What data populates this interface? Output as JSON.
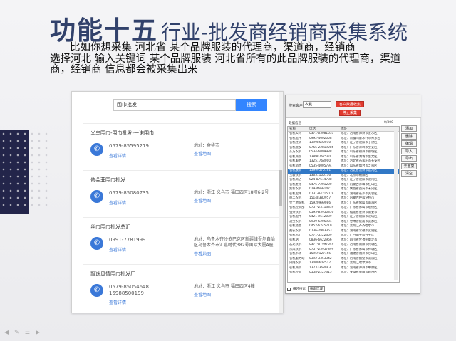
{
  "slide": {
    "title_big": "功能十五",
    "title_sub": "行业-批发商经销商采集系统",
    "desc_line1": "比如你想采集 河北省 某个品牌服装的代理商，渠道商，经销商",
    "desc_line2": "选择河北 输入关键词 某个品牌服装  河北省所有的此品牌服装的代理商，渠道",
    "desc_line3": "商，经销商  信息都会被采集出来"
  },
  "browser": {
    "search_value": "围巾批发",
    "search_button": "搜索",
    "results": [
      {
        "name": "义乌围巾-围巾批发-一诺围巾",
        "phone": "0579-85595219",
        "phone2": "",
        "detail": "查看详情",
        "addr": "地址：金华市",
        "map": "查看地图"
      },
      {
        "name": "依朵菲围巾批发",
        "phone": "0579-85080735",
        "phone2": "",
        "detail": "查看详情",
        "addr": "地址：浙江 义乌市 福田四区18幢6-2号",
        "map": "查看地图"
      },
      {
        "name": "丝巾围巾批发总汇",
        "phone": "0991-7781999",
        "phone2": "",
        "detail": "查看详情",
        "addr": "地址：乌鲁木齐沙依巴克区新疆维吾尔自治区乌鲁木齐市汇嘉时代382号国际大厦A座",
        "map": "查看地图"
      },
      {
        "name": "飘逸风情围巾批发厂",
        "phone": "0579-85054648",
        "phone2": "15988500199",
        "detail": "查看详情",
        "addr": "地址：浙江 义乌市 福田四区4幢",
        "map": "查看地图"
      }
    ]
  },
  "app": {
    "keyword_label": "搜索客户",
    "keyword_value": "农机",
    "btn_start": "客户数据收集",
    "btn_stop": "停止采集",
    "data_label": "数据信息",
    "count": "0/300",
    "columns": [
      "名称",
      "电话",
      "地址"
    ],
    "rows": [
      [
        "农机公司",
        "0371-65081631",
        "地址：河南省郑州市金水区"
      ],
      [
        "农机配件",
        "0992-4602058",
        "地址：新疆乌鲁木齐市米东区"
      ],
      [
        "农机经销",
        "13998590010",
        "地址：辽宁省沈阳市于洪区"
      ],
      [
        "农机批发",
        "0755-22819286",
        "地址：广东省深圳市宝安区"
      ],
      [
        "东方农机",
        "0534-6099988",
        "地址：山东省德州市德城区"
      ],
      [
        "农机商城",
        "13898767590",
        "地址：山东省潍坊市奎文区"
      ],
      [
        "农机服务",
        "13251768000",
        "地址：河北省石家庄市长安区"
      ],
      [
        "农机销售",
        "0535-4005794",
        "地址：山东省烟台市芝罘区"
      ],
      [
        "农机展销",
        "13999570161",
        "地址：河北省沧州市运河区"
      ],
      [
        "宝骏农机",
        "13651106116",
        "地址：北京市朝阳区"
      ],
      [
        "农机商店",
        "024-87514788",
        "地址：辽宁省沈阳市沈河区"
      ],
      [
        "农机维修",
        "0476-7201200",
        "地址：内蒙古赤峰市红山区"
      ],
      [
        "凯新农机",
        "029-46661471",
        "地址：陕西省西安市未央区"
      ],
      [
        "农机配件",
        "0731-84215079",
        "地址：湖南省长沙市芙蓉区"
      ],
      [
        "益丰农机",
        "15148380957",
        "地址：内蒙古呼和浩特市"
      ],
      [
        "金土地农机",
        "15920999086",
        "地址：广东省佛山市南海区"
      ],
      [
        "农机经销部",
        "0757-23113339",
        "地址：广东省佛山市顺德区"
      ],
      [
        "强兴农机",
        "0595-85950350",
        "地址：福建省泉州市南安市"
      ],
      [
        "农机配件",
        "0421-9512039",
        "地址：辽宁省朝阳市双塔区"
      ],
      [
        "通宝农机",
        "0939-5205934",
        "地址：甘肃省陇南市武都区"
      ],
      [
        "农机经营",
        "0452-6245719",
        "地址：黑龙江齐齐哈尔市"
      ],
      [
        "鑫农农机",
        "0736-2993363",
        "地址：湖南省常德市武陵区"
      ],
      [
        "农机总汇",
        "0771-5222369",
        "地址：广西南宁市兴宁区"
      ],
      [
        "农机站",
        "0836-6622966",
        "地址：四川省甘孜州康定市"
      ],
      [
        "宏达农机",
        "0377-67997549",
        "地址：河南省南阳市宛城区"
      ],
      [
        "东风农机",
        "0757-25957899",
        "地址：广东省佛山市禅城区"
      ],
      [
        "农机市场",
        "15959127155",
        "地址：福建省福州市仓山区"
      ],
      [
        "农机服务站",
        "0392-3353342",
        "地址：河南省鹤壁市淇滨区"
      ],
      [
        "兴隆农机",
        "13009602517",
        "地址：黑龙江哈尔滨市"
      ],
      [
        "农机商贸",
        "13733368983",
        "地址：河南省郑州市中原区"
      ],
      [
        "农机经销",
        "0558-2227315",
        "地址：安徽省阜阳市颍州区"
      ]
    ],
    "side_buttons": [
      "添加",
      "删除",
      "编辑",
      "导入",
      "导出",
      "去重复",
      "清空"
    ],
    "footer_check": "循环搜索",
    "footer_dropdown": "搜索区域"
  }
}
